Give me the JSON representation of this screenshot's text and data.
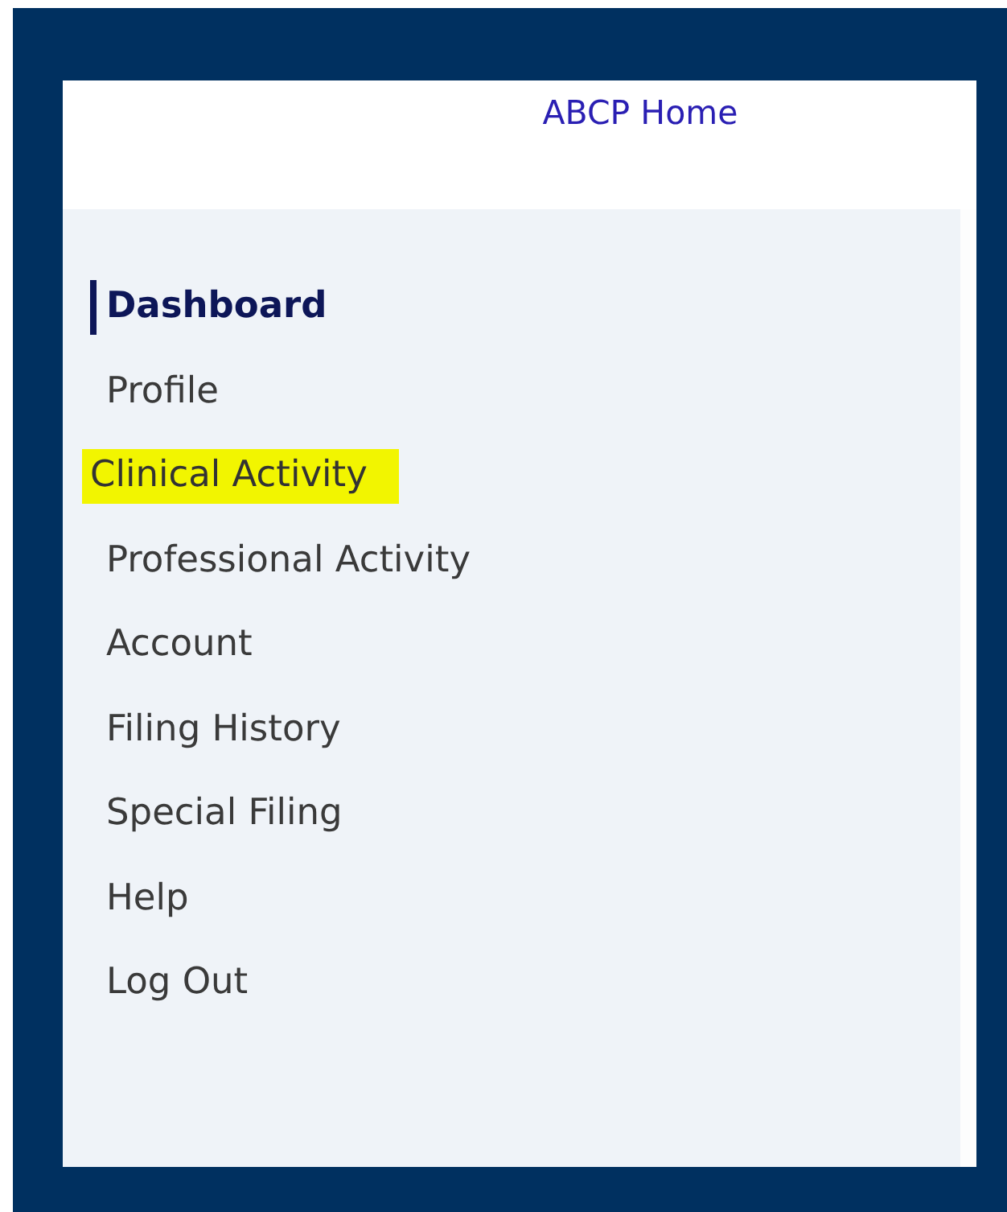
{
  "header": {
    "link": "ABCP Home"
  },
  "sidebar": {
    "items": [
      {
        "label": "Dashboard",
        "selected": true,
        "highlighted": false
      },
      {
        "label": "Profile",
        "selected": false,
        "highlighted": false
      },
      {
        "label": "Clinical Activity",
        "selected": false,
        "highlighted": true
      },
      {
        "label": "Professional Activity",
        "selected": false,
        "highlighted": false
      },
      {
        "label": "Account",
        "selected": false,
        "highlighted": false
      },
      {
        "label": "Filing History",
        "selected": false,
        "highlighted": false
      },
      {
        "label": "Special Filing",
        "selected": false,
        "highlighted": false
      },
      {
        "label": "Help",
        "selected": false,
        "highlighted": false
      },
      {
        "label": "Log Out",
        "selected": false,
        "highlighted": false
      }
    ]
  }
}
